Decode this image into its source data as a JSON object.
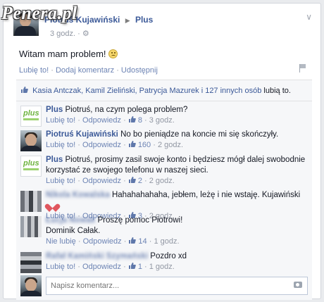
{
  "watermark": "Penera.pl",
  "post": {
    "author": "Piotruś Kujawiński",
    "target": "Plus",
    "time": "3 godz.",
    "text": "Witam mam problem!",
    "actions": [
      "Lubię to!",
      "Dodaj komentarz",
      "Udostępnij"
    ]
  },
  "likes": {
    "names": "Kasia Antczak, Kamil Zieliński, Patrycja Mazurek i 127 innych osób",
    "suffix": "lubią to."
  },
  "comments": [
    {
      "author": "Plus",
      "text": "Piotruś, na czym polega problem?",
      "like_label": "Lubię to!",
      "reply": "Odpowiedz",
      "likes": "8",
      "time": "3 godz.",
      "avatar": "plus"
    },
    {
      "author": "Piotruś Kujawiński",
      "text": "No bo pieniądze na koncie mi się skończyły.",
      "like_label": "Lubię to!",
      "reply": "Odpowiedz",
      "likes": "160",
      "time": "2 godz.",
      "avatar": "photo"
    },
    {
      "author": "Plus",
      "text": "Piotruś, prosimy zasil swoje konto i będziesz mógł dalej swobodnie korzystać ze swojego telefonu w naszej sieci.",
      "like_label": "Lubię to!",
      "reply": "Odpowiedz",
      "likes": "2",
      "time": "2 godz.",
      "avatar": "plus"
    },
    {
      "author": "Hahahahahaha",
      "text": "Hahahahahaha, jebłem, leżę i nie wstaję. Kujawiński",
      "like_label": "Lubię to!",
      "reply": "Odpowiedz",
      "likes": "3",
      "time": "2 godz.",
      "avatar": "pix"
    },
    {
      "author": "Proszę",
      "text": "Proszę pomoc Piotrowi!",
      "text2": "Dominik Całak.",
      "like_label": "Nie lubię",
      "reply": "Odpowiedz",
      "likes": "14",
      "time": "1 godz.",
      "avatar": "pix"
    },
    {
      "author": "Pozdro",
      "text": "Pozdro xd",
      "like_label": "Lubię to!",
      "reply": "Odpowiedz",
      "likes": "1",
      "time": "1 godz.",
      "avatar": "pix"
    }
  ],
  "comment_input": {
    "placeholder": "Napisz komentarz..."
  },
  "colors": {
    "link": "#3b5998",
    "meta": "#9197a3",
    "background": "#f6f7f9"
  }
}
